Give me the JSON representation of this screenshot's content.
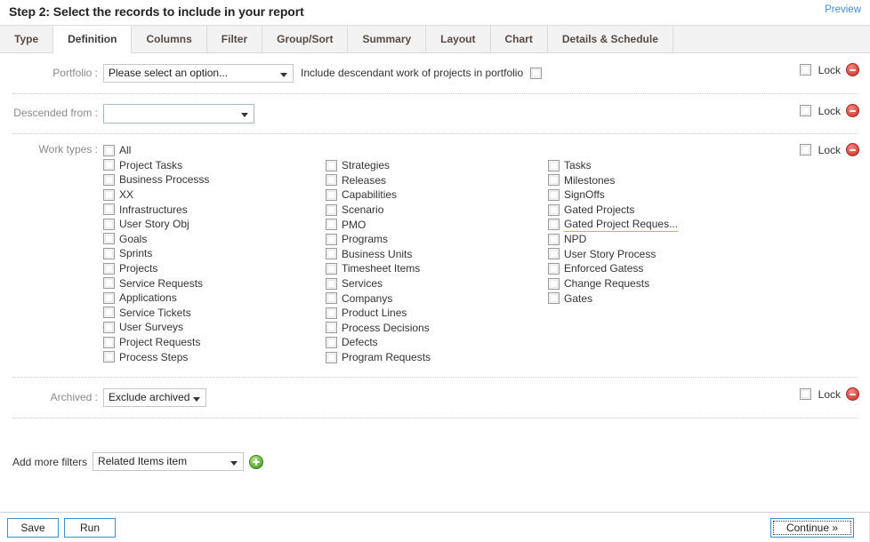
{
  "header": {
    "title": "Step 2: Select the records to include in your report",
    "preview_label": "Preview"
  },
  "tabs": [
    {
      "label": "Type",
      "active": false
    },
    {
      "label": "Definition",
      "active": true
    },
    {
      "label": "Columns",
      "active": false
    },
    {
      "label": "Filter",
      "active": false
    },
    {
      "label": "Group/Sort",
      "active": false
    },
    {
      "label": "Summary",
      "active": false
    },
    {
      "label": "Layout",
      "active": false
    },
    {
      "label": "Chart",
      "active": false
    },
    {
      "label": "Details & Schedule",
      "active": false
    }
  ],
  "rows": {
    "portfolio": {
      "label": "Portfolio :",
      "select_value": "Please select an option...",
      "descendant_label": "Include descendant work of projects in portfolio",
      "lock_label": "Lock"
    },
    "descended": {
      "label": "Descended from :",
      "select_value": "",
      "lock_label": "Lock"
    },
    "worktypes": {
      "label": "Work types :",
      "lock_label": "Lock",
      "columns": [
        [
          "All",
          "Project Tasks",
          "Business Processs",
          "XX",
          "Infrastructures",
          "User Story Obj",
          "Goals",
          "Sprints",
          "Projects",
          "Service Requests",
          "Applications",
          "Service Tickets",
          "User Surveys",
          "Project Requests",
          "Process Steps"
        ],
        [
          "Strategies",
          "Releases",
          "Capabilities",
          "Scenario",
          "PMO",
          "Programs",
          "Business Units",
          "Timesheet Items",
          "Services",
          "Companys",
          "Product Lines",
          "Process Decisions",
          "Defects",
          "Program Requests"
        ],
        [
          "Tasks",
          "Milestones",
          "SignOffs",
          "Gated Projects",
          "Gated Project Reques...",
          "NPD",
          "User Story Process",
          "Enforced Gatess",
          "Change Requests",
          "Gates"
        ]
      ],
      "truncated_item": "Gated Project Reques..."
    },
    "archived": {
      "label": "Archived :",
      "select_value": "Exclude archived",
      "lock_label": "Lock"
    }
  },
  "add_filters": {
    "label": "Add more filters",
    "select_value": "Related Items item",
    "add_icon": "plus-circle-icon"
  },
  "footer": {
    "save_label": "Save",
    "run_label": "Run",
    "continue_label": "Continue »"
  },
  "colors": {
    "accent": "#3b8fd4",
    "tab_text": "#5a4a42",
    "remove": "#d8443c",
    "add": "#6eb844",
    "truncate_underline": "#e0a955"
  }
}
